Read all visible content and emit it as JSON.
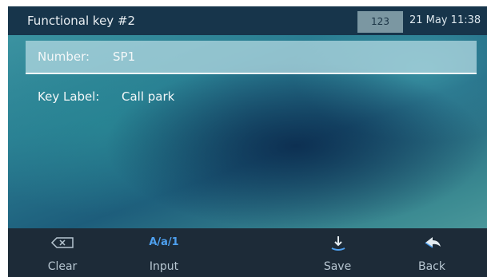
{
  "header": {
    "title": "Functional key #2",
    "mode_badge": "123",
    "datetime": "21 May 11:38"
  },
  "form": {
    "rows": [
      {
        "label": "Number:",
        "value": "SP1",
        "selected": true
      },
      {
        "label": "Key Label:",
        "value": "Call park",
        "selected": false
      }
    ]
  },
  "softkeys": [
    {
      "label": "Clear",
      "icon": "backspace-icon"
    },
    {
      "label": "Input",
      "icon_text": "A/a/1",
      "icon": "input-mode-icon"
    },
    {
      "label": "Save",
      "icon": "save-download-icon"
    },
    {
      "label": "Back",
      "icon": "back-arrow-icon"
    }
  ],
  "colors": {
    "titlebar": "#17354b",
    "softkey_bar": "#1d2b38",
    "accent": "#4ea0ef",
    "selected_row": "#b9dde4"
  }
}
